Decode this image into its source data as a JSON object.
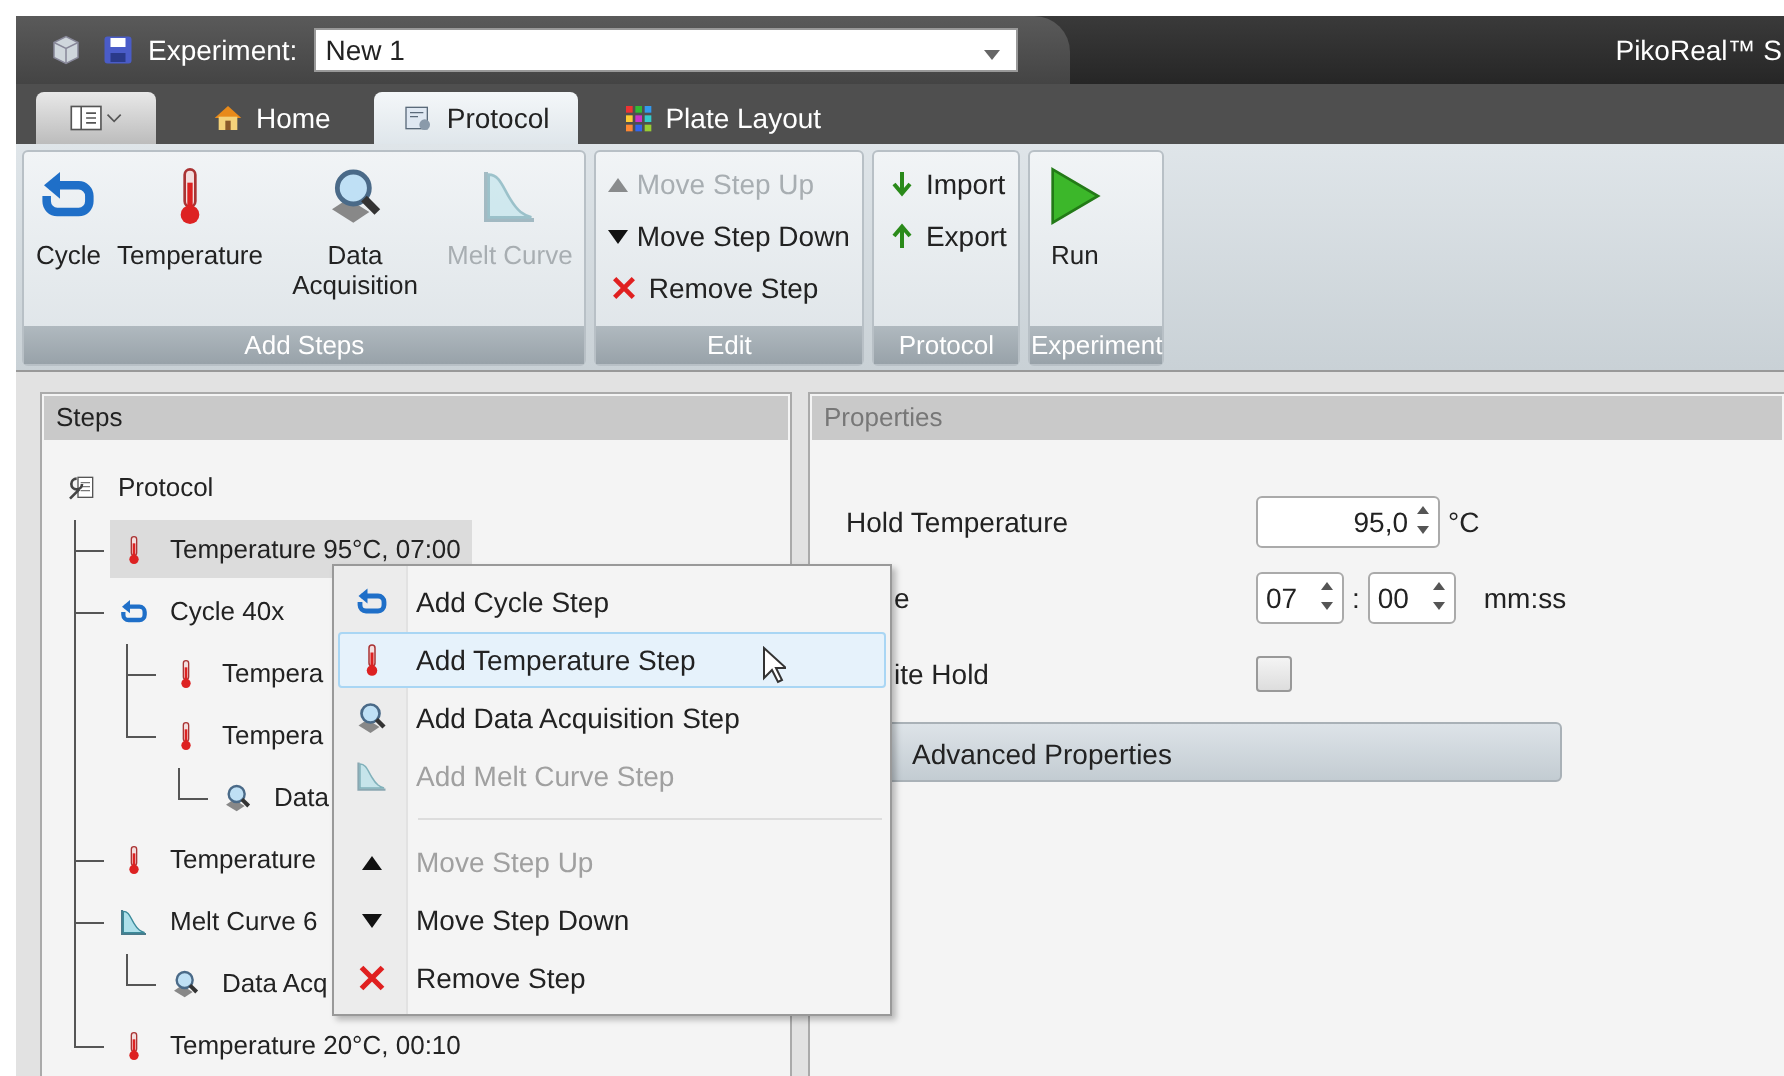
{
  "title_bar": {
    "experiment_label": "Experiment:",
    "experiment_value": "New 1",
    "app_name": "PikoReal™ S"
  },
  "tabs": [
    {
      "kind": "menu",
      "selected": false
    },
    {
      "kind": "home",
      "label": "Home",
      "selected": false
    },
    {
      "kind": "protocol",
      "label": "Protocol",
      "selected": true
    },
    {
      "kind": "plate",
      "label": "Plate Layout",
      "selected": false
    }
  ],
  "ribbon": [
    {
      "title": "Add Steps",
      "items": [
        {
          "kind": "cycle",
          "label": "Cycle",
          "disabled": false
        },
        {
          "kind": "temperature",
          "label": "Temperature",
          "disabled": false
        },
        {
          "kind": "data",
          "label": "Data Acquisition",
          "disabled": false
        },
        {
          "kind": "melt",
          "label": "Melt Curve",
          "disabled": true
        }
      ]
    },
    {
      "title": "Edit",
      "items": [
        {
          "kind": "up",
          "label": "Move Step Up",
          "disabled": true
        },
        {
          "kind": "down",
          "label": "Move Step Down",
          "disabled": false
        },
        {
          "kind": "remove",
          "label": "Remove Step",
          "disabled": false
        }
      ]
    },
    {
      "title": "Protocol",
      "items": [
        {
          "kind": "import",
          "label": "Import",
          "disabled": false
        },
        {
          "kind": "export",
          "label": "Export",
          "disabled": false
        }
      ]
    },
    {
      "title": "Experiment",
      "items": [
        {
          "kind": "run",
          "label": "Run",
          "disabled": false
        }
      ]
    }
  ],
  "steps_panel": {
    "title": "Steps",
    "tree": [
      {
        "kind": "protocol",
        "label": "Protocol",
        "selected": false,
        "children": [
          {
            "kind": "temperature",
            "label": "Temperature 95°C, 07:00",
            "selected": true
          },
          {
            "kind": "cycle",
            "label": "Cycle 40x",
            "selected": false,
            "children": [
              {
                "kind": "temperature",
                "label": "Tempera",
                "selected": false
              },
              {
                "kind": "temperature",
                "label": "Tempera",
                "selected": false,
                "children": [
                  {
                    "kind": "data",
                    "label": "Data",
                    "selected": false
                  }
                ]
              }
            ]
          },
          {
            "kind": "temperature",
            "label": "Temperature",
            "selected": false
          },
          {
            "kind": "melt",
            "label": "Melt Curve 6",
            "selected": false,
            "children": [
              {
                "kind": "data",
                "label": "Data Acq",
                "selected": false
              }
            ]
          },
          {
            "kind": "temperature",
            "label": "Temperature 20°C, 00:10",
            "selected": false
          }
        ]
      }
    ]
  },
  "properties_panel": {
    "title": "Properties",
    "fields": [
      {
        "kind": "number",
        "label": "Hold Temperature",
        "value": "95,0",
        "unit": "°C"
      },
      {
        "kind": "time",
        "label": "e",
        "minutes": "07",
        "separator": ":",
        "seconds": "00",
        "unit": "mm:ss"
      },
      {
        "kind": "checkbox",
        "label": "ite Hold",
        "checked": false
      }
    ],
    "advanced": "Advanced Properties"
  },
  "context_menu": [
    {
      "kind": "cycle",
      "label": "Add Cycle Step",
      "disabled": false,
      "selected": false
    },
    {
      "kind": "temperature",
      "label": "Add Temperature Step",
      "disabled": false,
      "selected": true
    },
    {
      "kind": "data",
      "label": "Add Data Acquisition Step",
      "disabled": false,
      "selected": false
    },
    {
      "kind": "melt",
      "label": "Add Melt Curve Step",
      "disabled": true,
      "selected": false
    },
    {
      "kind": "separator"
    },
    {
      "kind": "up",
      "label": "Move Step Up",
      "disabled": true,
      "selected": false
    },
    {
      "kind": "down",
      "label": "Move Step Down",
      "disabled": false,
      "selected": false
    },
    {
      "kind": "remove",
      "label": "Remove Step",
      "disabled": false,
      "selected": false
    }
  ]
}
